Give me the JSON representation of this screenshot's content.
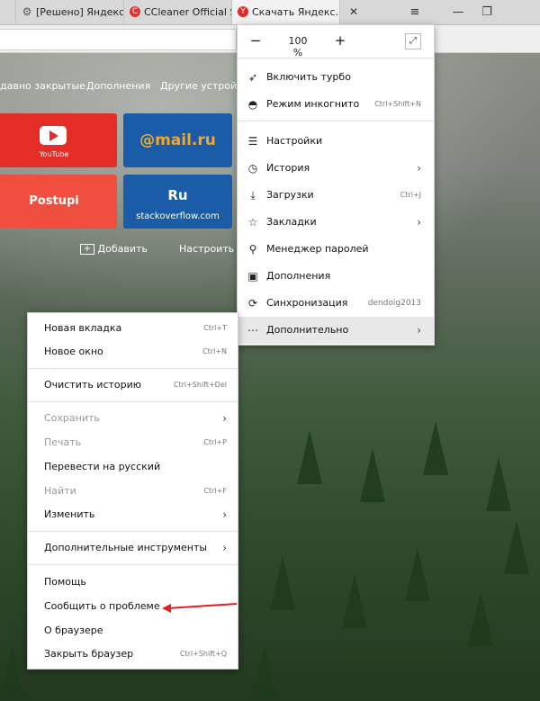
{
  "tabs": [
    {
      "title": "[Решено] Яндекс б",
      "icon": "gear-icon"
    },
    {
      "title": "CCleaner Official Si",
      "icon": "ccleaner-icon"
    },
    {
      "title": "Скачать Яндекс.Бра",
      "icon": "yandex-browser-icon"
    }
  ],
  "tab_close": "✕",
  "window": {
    "menu": "≡",
    "minimize": "—",
    "restore": "❐"
  },
  "ntp": {
    "links": [
      "давно закрытые",
      "Дополнения",
      "Другие устройств"
    ],
    "tiles": [
      {
        "title": "",
        "subtitle": "YouTube",
        "color": "#e52d27"
      },
      {
        "title": "@mail.ru",
        "subtitle": "",
        "color": "#1b5ca8"
      },
      {
        "title": "Postupi",
        "subtitle": "",
        "color": "#f04e3e"
      },
      {
        "title": "Ru",
        "subtitle": "stackoverflow.com",
        "color": "#1b5ca8"
      }
    ],
    "add_label": "Добавить",
    "customize_label": "Настроить экра"
  },
  "main_menu": {
    "zoom": {
      "minus": "−",
      "value": "100 %",
      "plus": "+",
      "fullscreen": "⤢"
    },
    "items": [
      {
        "label": "Включить турбо",
        "icon": "rocket-icon",
        "shortcut": "",
        "arrow": false
      },
      {
        "label": "Режим инкогнито",
        "icon": "incognito-icon",
        "shortcut": "Ctrl+Shift+N",
        "arrow": false
      },
      {
        "label": "Настройки",
        "icon": "settings-sliders-icon",
        "shortcut": "",
        "arrow": false
      },
      {
        "label": "История",
        "icon": "history-clock-icon",
        "shortcut": "",
        "arrow": true
      },
      {
        "label": "Загрузки",
        "icon": "download-icon",
        "shortcut": "Ctrl+J",
        "arrow": false
      },
      {
        "label": "Закладки",
        "icon": "bookmark-star-icon",
        "shortcut": "",
        "arrow": true
      },
      {
        "label": "Менеджер паролей",
        "icon": "key-icon",
        "shortcut": "",
        "arrow": false
      },
      {
        "label": "Дополнения",
        "icon": "extensions-icon",
        "shortcut": "",
        "arrow": false
      },
      {
        "label": "Синхронизация",
        "icon": "sync-icon",
        "shortcut": "dendoig2013",
        "arrow": false
      },
      {
        "label": "Дополнительно",
        "icon": "more-dots-icon",
        "shortcut": "",
        "arrow": true
      }
    ]
  },
  "sub_menu": {
    "items": [
      {
        "label": "Новая вкладка",
        "shortcut": "Ctrl+T",
        "disabled": false,
        "arrow": false
      },
      {
        "label": "Новое окно",
        "shortcut": "Ctrl+N",
        "disabled": false,
        "arrow": false
      },
      {
        "label": "Очистить историю",
        "shortcut": "Ctrl+Shift+Del",
        "disabled": false,
        "arrow": false
      },
      {
        "label": "Сохранить",
        "shortcut": "",
        "disabled": true,
        "arrow": true
      },
      {
        "label": "Печать",
        "shortcut": "Ctrl+P",
        "disabled": true,
        "arrow": false
      },
      {
        "label": "Перевести на русский",
        "shortcut": "",
        "disabled": false,
        "arrow": false
      },
      {
        "label": "Найти",
        "shortcut": "Ctrl+F",
        "disabled": true,
        "arrow": false
      },
      {
        "label": "Изменить",
        "shortcut": "",
        "disabled": false,
        "arrow": true
      },
      {
        "label": "Дополнительные инструменты",
        "shortcut": "",
        "disabled": false,
        "arrow": true
      },
      {
        "label": "Помощь",
        "shortcut": "",
        "disabled": false,
        "arrow": false
      },
      {
        "label": "Сообщить о проблеме",
        "shortcut": "",
        "disabled": false,
        "arrow": false
      },
      {
        "label": "О браузере",
        "shortcut": "",
        "disabled": false,
        "arrow": false
      },
      {
        "label": "Закрыть браузер",
        "shortcut": "Ctrl+Shift+Q",
        "disabled": false,
        "arrow": false
      }
    ]
  },
  "colors": {
    "annotation_arrow": "#e0201e",
    "highlight": "#e8e8e8"
  }
}
